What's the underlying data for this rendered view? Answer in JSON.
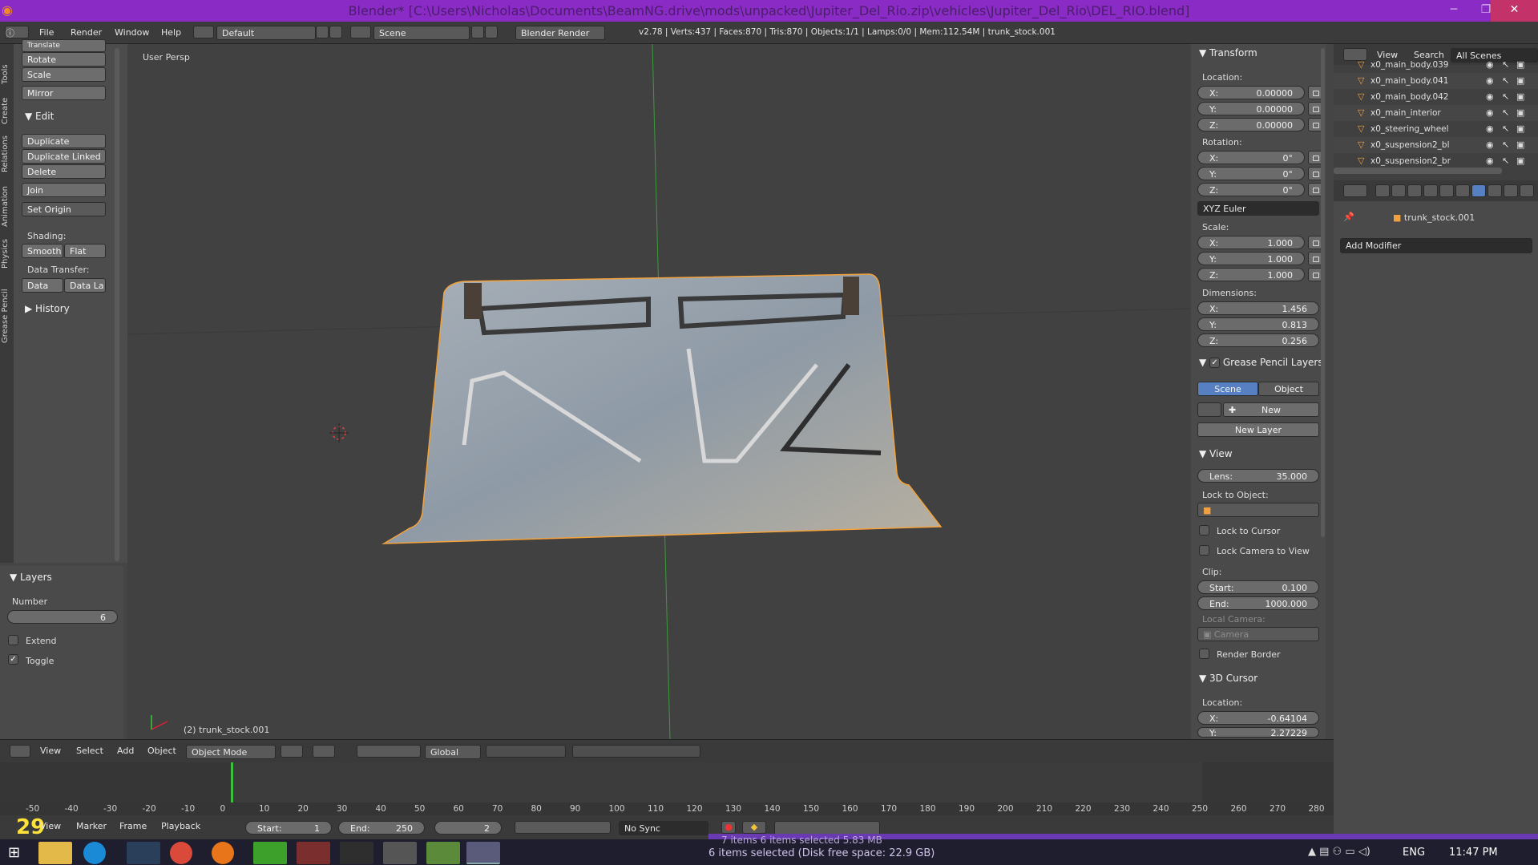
{
  "title": "Blender* [C:\\Users\\Nicholas\\Documents\\BeamNG.drive\\mods\\unpacked\\Jupiter_Del_Rio.zip\\vehicles\\Jupiter_Del_Rio\\DEL_RIO.blend]",
  "menu": {
    "file": "File",
    "render": "Render",
    "window": "Window",
    "help": "Help",
    "layout": "Default",
    "scene": "Scene",
    "engine": "Blender Render",
    "stats": "v2.78 | Verts:437 | Faces:870 | Tris:870 | Objects:1/1 | Lamps:0/0 | Mem:112.54M | trunk_stock.001"
  },
  "vtabs": [
    "Tools",
    "Create",
    "Relations",
    "Animation",
    "Physics",
    "Grease Pencil"
  ],
  "tools": {
    "translate": "Translate",
    "rotate": "Rotate",
    "scale": "Scale",
    "mirror": "Mirror",
    "edit": "Edit",
    "duplicate": "Duplicate",
    "duplicate_linked": "Duplicate Linked",
    "delete": "Delete",
    "join": "Join",
    "set_origin": "Set Origin",
    "shading": "Shading:",
    "smooth": "Smooth",
    "flat": "Flat",
    "data_transfer": "Data Transfer:",
    "data": "Data",
    "data_la": "Data La",
    "history": "History"
  },
  "layers": {
    "header": "Layers",
    "number_label": "Number",
    "number": "6",
    "extend": "Extend",
    "toggle": "Toggle"
  },
  "viewport": {
    "persp": "User Persp",
    "object_label": "(2) trunk_stock.001"
  },
  "props": {
    "transform": "Transform",
    "location": "Location:",
    "rotation": "Rotation:",
    "scale": "Scale:",
    "dimensions": "Dimensions:",
    "x": "X:",
    "y": "Y:",
    "z": "Z:",
    "loc": [
      "0.00000",
      "0.00000",
      "0.00000"
    ],
    "rot": [
      "0°",
      "0°",
      "0°"
    ],
    "rot_mode": "XYZ Euler",
    "scl": [
      "1.000",
      "1.000",
      "1.000"
    ],
    "dim": [
      "1.456",
      "0.813",
      "0.256"
    ],
    "gp_layers": "Grease Pencil Layers",
    "gp_scene": "Scene",
    "gp_object": "Object",
    "gp_new": "New",
    "gp_new_layer": "New Layer",
    "view": "View",
    "lens": "Lens:",
    "lens_val": "35.000",
    "lock_obj": "Lock to Object:",
    "lock_cursor": "Lock to Cursor",
    "lock_cam": "Lock Camera to View",
    "clip": "Clip:",
    "clip_start": "Start:",
    "clip_start_val": "0.100",
    "clip_end": "End:",
    "clip_end_val": "1000.000",
    "local_cam": "Local Camera:",
    "camera": "Camera",
    "render_border": "Render Border",
    "cursor": "3D Cursor",
    "cur_location": "Location:",
    "cur_x": "-0.64104",
    "cur_y": "2.27229"
  },
  "outliner": {
    "view": "View",
    "search": "Search",
    "scenes": "All Scenes",
    "items": [
      "x0_main_body.039",
      "x0_main_body.041",
      "x0_main_body.042",
      "x0_main_interior",
      "x0_steering_wheel",
      "x0_suspension2_bl",
      "x0_suspension2_br"
    ]
  },
  "modifiers": {
    "object": "trunk_stock.001",
    "add": "Add Modifier"
  },
  "vhdr": {
    "view": "View",
    "select": "Select",
    "add": "Add",
    "object": "Object",
    "mode": "Object Mode",
    "orient": "Global"
  },
  "ruler": [
    "-50",
    "-40",
    "-30",
    "-20",
    "-10",
    "0",
    "10",
    "20",
    "30",
    "40",
    "50",
    "60",
    "70",
    "80",
    "90",
    "100",
    "110",
    "120",
    "130",
    "140",
    "150",
    "160",
    "170",
    "180",
    "190",
    "200",
    "210",
    "220",
    "230",
    "240",
    "250",
    "260",
    "270",
    "280"
  ],
  "thdr": {
    "fps": "29",
    "view": "View",
    "marker": "Marker",
    "frame": "Frame",
    "playback": "Playback",
    "start": "Start:",
    "start_val": "1",
    "end": "End:",
    "end_val": "250",
    "current": "2",
    "sync": "No Sync"
  },
  "info": {
    "line1": "7 items   6 items selected  5.83 MB",
    "line2": "6 items selected (Disk free space: 22.9 GB)"
  },
  "taskbar": {
    "lang": "ENG",
    "time": "11:47 PM"
  },
  "colors": {
    "title": "#8a2bc6",
    "accent": "#5680c2",
    "selection": "#f5a23a"
  }
}
